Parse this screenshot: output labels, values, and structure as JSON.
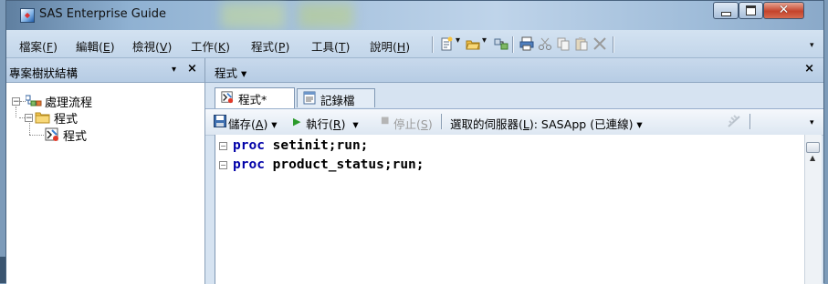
{
  "window": {
    "title": "SAS Enterprise Guide"
  },
  "menubar": {
    "items": [
      {
        "label": "檔案(",
        "key": "F",
        "end": ")"
      },
      {
        "label": "編輯(",
        "key": "E",
        "end": ")"
      },
      {
        "label": "檢視(",
        "key": "V",
        "end": ")"
      },
      {
        "label": "工作(",
        "key": "K",
        "end": ")"
      },
      {
        "label": "程式(",
        "key": "P",
        "end": ")"
      },
      {
        "label": "工具(",
        "key": "T",
        "end": ")"
      },
      {
        "label": "說明(",
        "key": "H",
        "end": ")"
      }
    ]
  },
  "project_tree": {
    "title": "專案樹狀結構",
    "dropdown": "▾",
    "close": "×",
    "nodes": [
      {
        "label": "處理流程"
      },
      {
        "label": "程式"
      },
      {
        "label": "程式"
      }
    ]
  },
  "document": {
    "title": "程式 ▾",
    "close": "×",
    "tabs": [
      {
        "label": "程式*"
      },
      {
        "label": "記錄檔"
      }
    ],
    "toolbar": {
      "save": "儲存(",
      "save_key": "A",
      "run": "執行(",
      "run_key": "R",
      "stop": "停止(",
      "stop_key": "S",
      "server_label": "選取的伺服器(",
      "server_key": "L",
      "server_value": "): SASApp (已連線)"
    },
    "code_lines": [
      {
        "kw": "proc",
        "rest": " setinit;run;"
      },
      {
        "kw": "proc",
        "rest": " product_status;run;"
      }
    ]
  }
}
